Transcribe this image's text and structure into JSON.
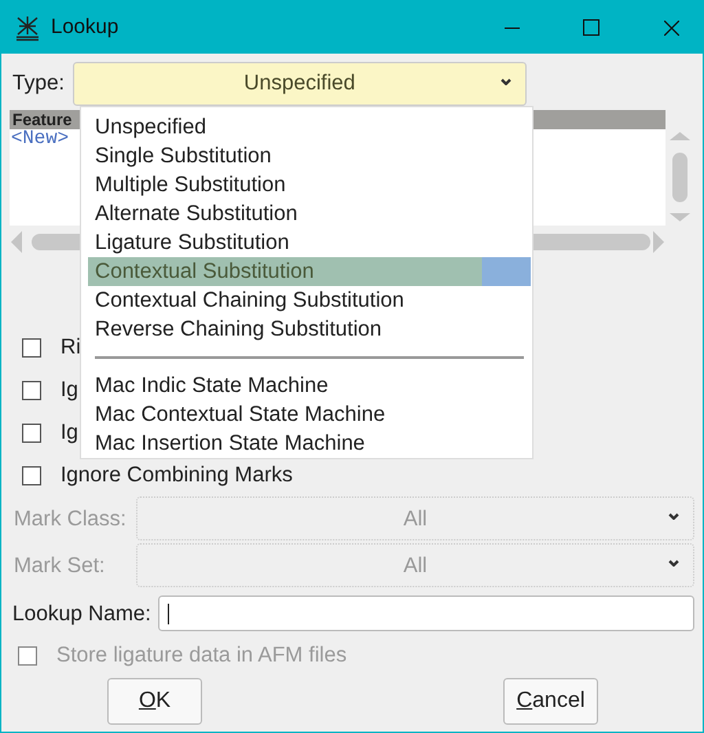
{
  "window": {
    "title": "Lookup"
  },
  "type_field": {
    "label": "Type:",
    "value": "Unspecified"
  },
  "feature_list": {
    "header": "Feature",
    "rows": [
      "<New>"
    ]
  },
  "flags": [
    {
      "label": "Ri",
      "checked": false
    },
    {
      "label": "Ig",
      "checked": false
    },
    {
      "label": "Ig",
      "checked": false
    },
    {
      "label": "Ignore Combining Marks",
      "checked": false
    }
  ],
  "mark_class": {
    "label": "Mark Class:",
    "value": "All",
    "disabled": true
  },
  "mark_set": {
    "label": "Mark Set:",
    "value": "All",
    "disabled": true
  },
  "lookup_name": {
    "label": "Lookup Name:"
  },
  "store_ligature": {
    "label": "Store ligature data in AFM files",
    "checked": false,
    "disabled": true
  },
  "buttons": [
    {
      "accel": "O",
      "rest": "K"
    },
    {
      "accel": "C",
      "rest": "ancel"
    }
  ],
  "type_dropdown": {
    "items": [
      {
        "kind": "option",
        "label": "Unspecified",
        "selected": false
      },
      {
        "kind": "option",
        "label": "Single Substitution",
        "selected": false
      },
      {
        "kind": "option",
        "label": "Multiple Substitution",
        "selected": false
      },
      {
        "kind": "option",
        "label": "Alternate Substitution",
        "selected": false
      },
      {
        "kind": "option",
        "label": "Ligature Substitution",
        "selected": false
      },
      {
        "kind": "option",
        "label": "Contextual Substitution",
        "selected": true
      },
      {
        "kind": "option",
        "label": "Contextual Chaining Substitution",
        "selected": false
      },
      {
        "kind": "option",
        "label": "Reverse Chaining Substitution",
        "selected": false
      },
      {
        "kind": "separator"
      },
      {
        "kind": "option",
        "label": "Mac Indic State Machine",
        "selected": false
      },
      {
        "kind": "option",
        "label": "Mac Contextual State Machine",
        "selected": false
      },
      {
        "kind": "option",
        "label": "Mac Insertion State Machine",
        "selected": false
      }
    ]
  }
}
